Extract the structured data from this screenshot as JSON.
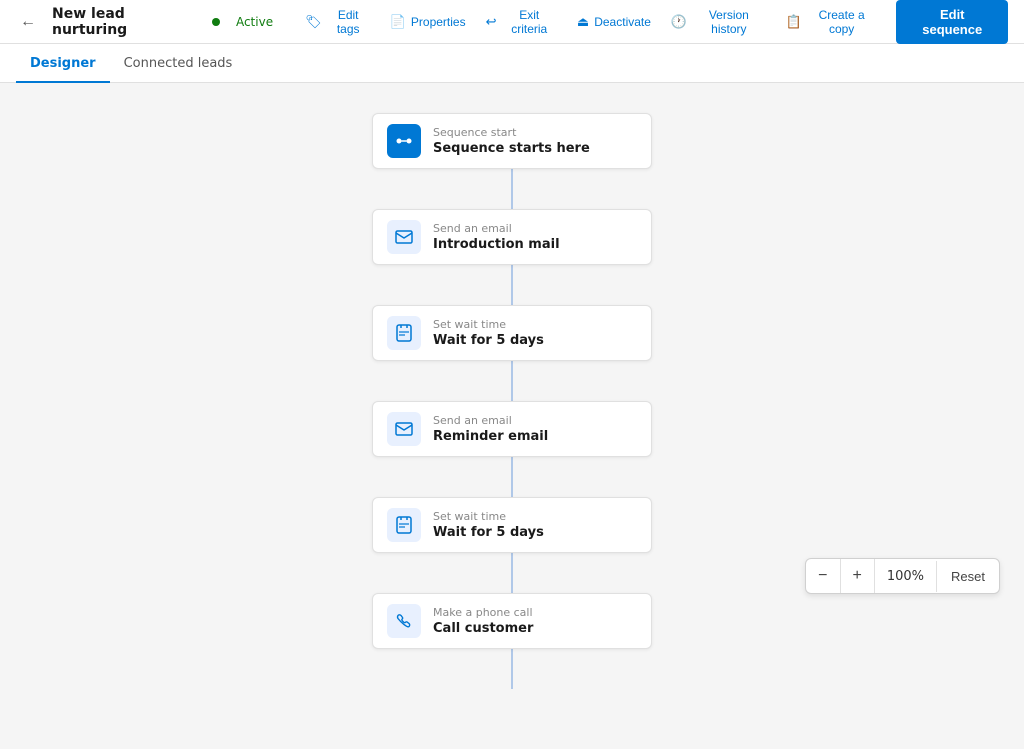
{
  "header": {
    "title": "New lead nurturing",
    "status": "Active",
    "back_label": "←",
    "actions": [
      {
        "id": "edit-tags",
        "icon": "🏷",
        "label": "Edit tags"
      },
      {
        "id": "properties",
        "icon": "📄",
        "label": "Properties"
      },
      {
        "id": "exit-criteria",
        "icon": "↩",
        "label": "Exit criteria"
      },
      {
        "id": "deactivate",
        "icon": "⏻",
        "label": "Deactivate"
      },
      {
        "id": "version-history",
        "icon": "🕐",
        "label": "Version history"
      },
      {
        "id": "create-copy",
        "icon": "📋",
        "label": "Create a copy"
      }
    ],
    "edit_button": "Edit sequence"
  },
  "tabs": [
    {
      "id": "designer",
      "label": "Designer",
      "active": true
    },
    {
      "id": "connected-leads",
      "label": "Connected leads",
      "active": false
    }
  ],
  "nodes": [
    {
      "id": "sequence-start",
      "icon_type": "start",
      "icon": "⇄",
      "label": "Sequence start",
      "title": "Sequence starts here"
    },
    {
      "id": "intro-mail",
      "icon_type": "email",
      "icon": "✉",
      "label": "Send an email",
      "title": "Introduction mail"
    },
    {
      "id": "wait-1",
      "icon_type": "wait",
      "icon": "⏱",
      "label": "Set wait time",
      "title": "Wait for 5 days"
    },
    {
      "id": "reminder-email",
      "icon_type": "email",
      "icon": "✉",
      "label": "Send an email",
      "title": "Reminder email"
    },
    {
      "id": "wait-2",
      "icon_type": "wait",
      "icon": "⏱",
      "label": "Set wait time",
      "title": "Wait for 5 days"
    },
    {
      "id": "phone-call",
      "icon_type": "phone",
      "icon": "📞",
      "label": "Make a phone call",
      "title": "Call customer"
    }
  ],
  "zoom": {
    "value": "100%",
    "minus": "−",
    "plus": "+",
    "reset": "Reset"
  }
}
